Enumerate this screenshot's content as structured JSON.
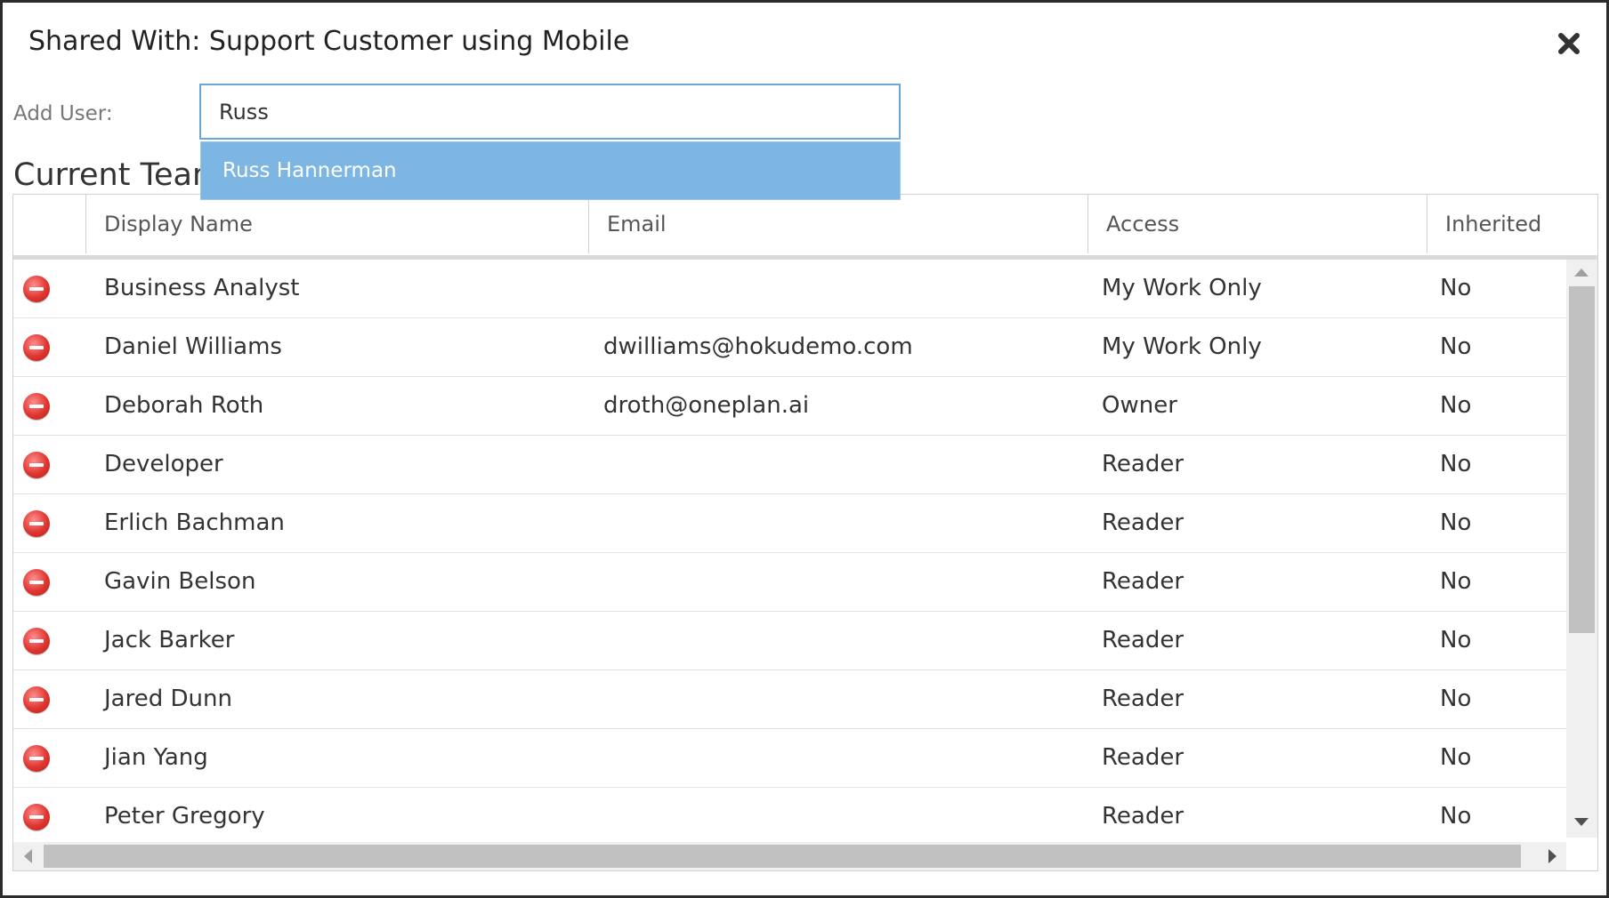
{
  "dialog": {
    "title": "Shared With: Support Customer using Mobile",
    "close_icon": "close-icon"
  },
  "add_user": {
    "label": "Add User:",
    "value": "Russ",
    "suggestions": [
      "Russ Hannerman"
    ]
  },
  "section_title": "Current Team",
  "columns": {
    "remove": "",
    "display_name": "Display Name",
    "email": "Email",
    "access": "Access",
    "inherited": "Inherited"
  },
  "rows": [
    {
      "display_name": "Business Analyst",
      "email": "",
      "access": "My Work Only",
      "inherited": "No"
    },
    {
      "display_name": "Daniel Williams",
      "email": "dwilliams@hokudemo.com",
      "access": "My Work Only",
      "inherited": "No"
    },
    {
      "display_name": "Deborah Roth",
      "email": "droth@oneplan.ai",
      "access": "Owner",
      "inherited": "No"
    },
    {
      "display_name": "Developer",
      "email": "",
      "access": "Reader",
      "inherited": "No"
    },
    {
      "display_name": "Erlich Bachman",
      "email": "",
      "access": "Reader",
      "inherited": "No"
    },
    {
      "display_name": "Gavin Belson",
      "email": "",
      "access": "Reader",
      "inherited": "No"
    },
    {
      "display_name": "Jack Barker",
      "email": "",
      "access": "Reader",
      "inherited": "No"
    },
    {
      "display_name": "Jared Dunn",
      "email": "",
      "access": "Reader",
      "inherited": "No"
    },
    {
      "display_name": "Jian Yang",
      "email": "",
      "access": "Reader",
      "inherited": "No"
    },
    {
      "display_name": "Peter Gregory",
      "email": "",
      "access": "Reader",
      "inherited": "No"
    }
  ],
  "colors": {
    "suggestion_bg": "#7db5e3",
    "input_border": "#6aa6d8",
    "remove_icon": "#e0352f"
  }
}
